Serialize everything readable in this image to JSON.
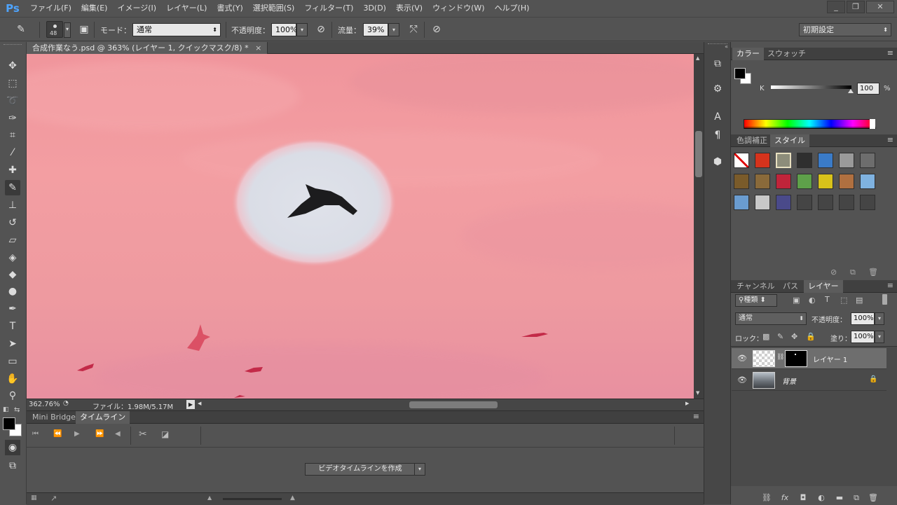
{
  "app": {
    "logo": "Ps"
  },
  "menu": [
    "ファイル(F)",
    "編集(E)",
    "イメージ(I)",
    "レイヤー(L)",
    "書式(Y)",
    "選択範囲(S)",
    "フィルター(T)",
    "3D(D)",
    "表示(V)",
    "ウィンドウ(W)",
    "ヘルプ(H)"
  ],
  "options": {
    "brush_size": "48",
    "mode_label": "モード：",
    "mode_value": "通常",
    "opacity_label": "不透明度：",
    "opacity_value": "100%",
    "flow_label": "流量：",
    "flow_value": "39%",
    "workspace": "初期設定"
  },
  "document": {
    "tab_title": "合成作業なう.psd @ 363% (レイヤー 1, クイックマスク/8) *",
    "zoom": "362.76%",
    "file_info": "ファイル：1.98M/5.17M"
  },
  "timeline": {
    "tabs": [
      "Mini Bridge",
      "タイムライン"
    ],
    "create_button": "ビデオタイムラインを作成"
  },
  "color_panel": {
    "tabs": [
      "カラー",
      "スウォッチ"
    ],
    "slider_label": "K",
    "value": "100",
    "unit": "%"
  },
  "styles_panel": {
    "tabs": [
      "色調補正",
      "スタイル"
    ],
    "swatches": [
      "#ffffff",
      "#d6331c",
      "#8d8d7a",
      "#2f2f2f",
      "#3a7bc8",
      "#9a9a9a",
      "#6d6d6d",
      "#7a5b2a",
      "#8a6a3a",
      "#c0243a",
      "#5ea04a",
      "#d8c21a",
      "#b07040",
      "#7fb2e0",
      "#6a9cd0",
      "#c8c8c8",
      "#4a4a8a",
      "#454545",
      "#454545",
      "#454545",
      "#454545"
    ]
  },
  "layers_panel": {
    "tabs": [
      "チャンネル",
      "パス",
      "レイヤー"
    ],
    "filter_label": "種類",
    "blend_mode": "通常",
    "opacity_label": "不透明度：",
    "opacity_value": "100%",
    "lock_label": "ロック：",
    "fill_label": "塗り：",
    "fill_value": "100%",
    "layers": [
      {
        "name": "レイヤー 1"
      },
      {
        "name": "背景"
      }
    ]
  }
}
